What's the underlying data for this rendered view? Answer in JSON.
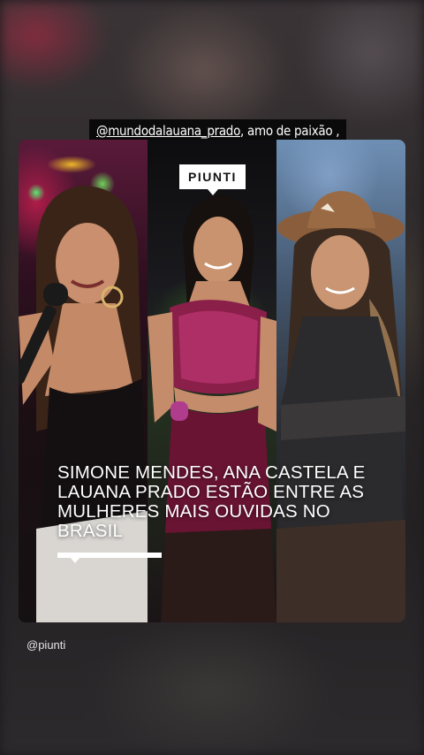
{
  "story": {
    "caption_mention": "@mundodalauana_prado",
    "caption_text": ", amo de paixão ,",
    "credit": "@piunti"
  },
  "post": {
    "brand": "PIUNTI",
    "headline": "SIMONE MENDES, ANA CASTELA E LAUANA PRADO ESTÃO ENTRE AS MULHERES MAIS OUVIDAS NO BRASIL",
    "photos": [
      {
        "icon": "singer-with-microphone"
      },
      {
        "icon": "singer-in-sparkly-outfit"
      },
      {
        "icon": "singer-in-cowboy-hat"
      }
    ]
  },
  "colors": {
    "caption_bg": "#0a0a0a",
    "badge_bg": "#ffffff",
    "text": "#ffffff"
  }
}
